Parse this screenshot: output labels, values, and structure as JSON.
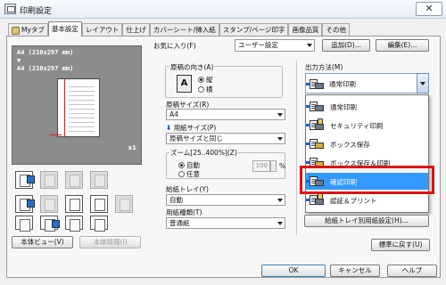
{
  "window": {
    "title": "印刷設定",
    "close_label": "✕"
  },
  "tabs": [
    "Myタブ",
    "基本設定",
    "レイアウト",
    "仕上げ",
    "カバーシート/挿入紙",
    "スタンプ/ページ印字",
    "画像品質",
    "その他"
  ],
  "active_tab_index": 1,
  "preview": {
    "line1": "A4 (210x297 mm)",
    "arrow": "▼",
    "line2": "A4 (210x297 mm)",
    "copies": "x1"
  },
  "left_buttons": {
    "printer_view": "本体ビュー(V)",
    "printer_info": "本体情報(I)"
  },
  "favorites": {
    "label": "お気に入り(F)",
    "value": "ユーザー設定",
    "add": "追加(D)...",
    "edit": "編集(E)..."
  },
  "orientation": {
    "label": "原稿の向き(A)",
    "icon_letter": "A",
    "options": [
      "縦",
      "横"
    ],
    "selected": 0
  },
  "original_size": {
    "label": "原稿サイズ(R)",
    "value": "A4"
  },
  "paper_size": {
    "label": "用紙サイズ(P)",
    "arrow": "⬇",
    "value": "原稿サイズと同じ"
  },
  "zoom": {
    "label": "ズーム[25..400%](Z)",
    "options": [
      "自動",
      "任意"
    ],
    "selected": 0,
    "value": "100",
    "unit": "%"
  },
  "paper_tray": {
    "label": "給紙トレイ(Y)",
    "value": "自動"
  },
  "paper_type": {
    "label": "用紙種類(T)",
    "value": "普通紙"
  },
  "output": {
    "label": "出力方法(M)",
    "current": "通常印刷",
    "options": [
      "通常印刷",
      "セキュリティ印刷",
      "ボックス保存",
      "ボックス保存＆印刷",
      "確認印刷",
      "認証＆プリント"
    ],
    "selected_index": 4,
    "highlight_color": "#3399ff",
    "callout_color": "#dd1111"
  },
  "tray_paper_settings": "給紙トレイ別用紙設定(H)...",
  "restore_defaults": "標準に戻す(U)",
  "footer": {
    "ok": "OK",
    "cancel": "キャンセル",
    "help": "ヘルプ"
  }
}
